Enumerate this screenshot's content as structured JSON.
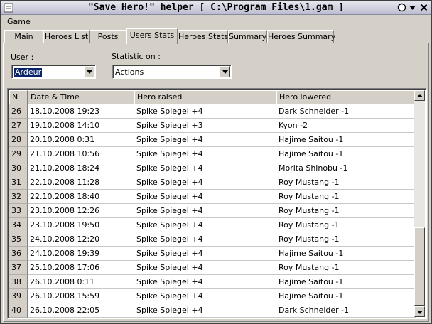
{
  "window": {
    "title": "\"Save Hero!\" helper [ C:\\Program Files\\1.gam ]"
  },
  "menu": {
    "items": [
      "Game"
    ]
  },
  "tabs": [
    {
      "label": "Main",
      "active": false
    },
    {
      "label": "Heroes List",
      "active": false
    },
    {
      "label": "Posts",
      "active": false
    },
    {
      "label": "Users Stats",
      "active": true
    },
    {
      "label": "Heroes Stats",
      "active": false
    },
    {
      "label": "Summary",
      "active": false
    },
    {
      "label": "Heroes Summary",
      "active": false
    }
  ],
  "filters": {
    "user_label": "User :",
    "user_value": "Ardeur",
    "statistic_label": "Statistic on :",
    "statistic_value": "Actions"
  },
  "table": {
    "columns": [
      "N",
      "Date & Time",
      "Hero raised",
      "Hero lowered"
    ],
    "rows": [
      [
        "26",
        "18.10.2008 19:23",
        "Spike Spiegel +4",
        "Dark Schneider -1"
      ],
      [
        "27",
        "19.10.2008 14:10",
        "Spike Spiegel +3",
        "Kyon -2"
      ],
      [
        "28",
        "20.10.2008 0:31",
        "Spike Spiegel +4",
        "Hajime Saitou -1"
      ],
      [
        "29",
        "21.10.2008 10:56",
        "Spike Spiegel +4",
        "Hajime Saitou -1"
      ],
      [
        "30",
        "21.10.2008 18:24",
        "Spike Spiegel +4",
        "Morita Shinobu -1"
      ],
      [
        "31",
        "22.10.2008 11:28",
        "Spike Spiegel +4",
        "Roy Mustang -1"
      ],
      [
        "32",
        "22.10.2008 18:40",
        "Spike Spiegel +4",
        "Roy Mustang -1"
      ],
      [
        "33",
        "23.10.2008 12:26",
        "Spike Spiegel +4",
        "Roy Mustang -1"
      ],
      [
        "34",
        "23.10.2008 19:50",
        "Spike Spiegel +4",
        "Roy Mustang -1"
      ],
      [
        "35",
        "24.10.2008 12:20",
        "Spike Spiegel +4",
        "Roy Mustang -1"
      ],
      [
        "36",
        "24.10.2008 19:39",
        "Spike Spiegel +4",
        "Hajime Saitou -1"
      ],
      [
        "37",
        "25.10.2008 17:06",
        "Spike Spiegel +4",
        "Roy Mustang -1"
      ],
      [
        "38",
        "26.10.2008 0:11",
        "Spike Spiegel +4",
        "Hajime Saitou -1"
      ],
      [
        "39",
        "26.10.2008 15:59",
        "Spike Spiegel +4",
        "Hajime Saitou -1"
      ],
      [
        "40",
        "26.10.2008 22:05",
        "Spike Spiegel +4",
        "Dark Schneider -1"
      ]
    ]
  },
  "colors": {
    "selection": "#0a246a",
    "face": "#d4d0c8"
  }
}
